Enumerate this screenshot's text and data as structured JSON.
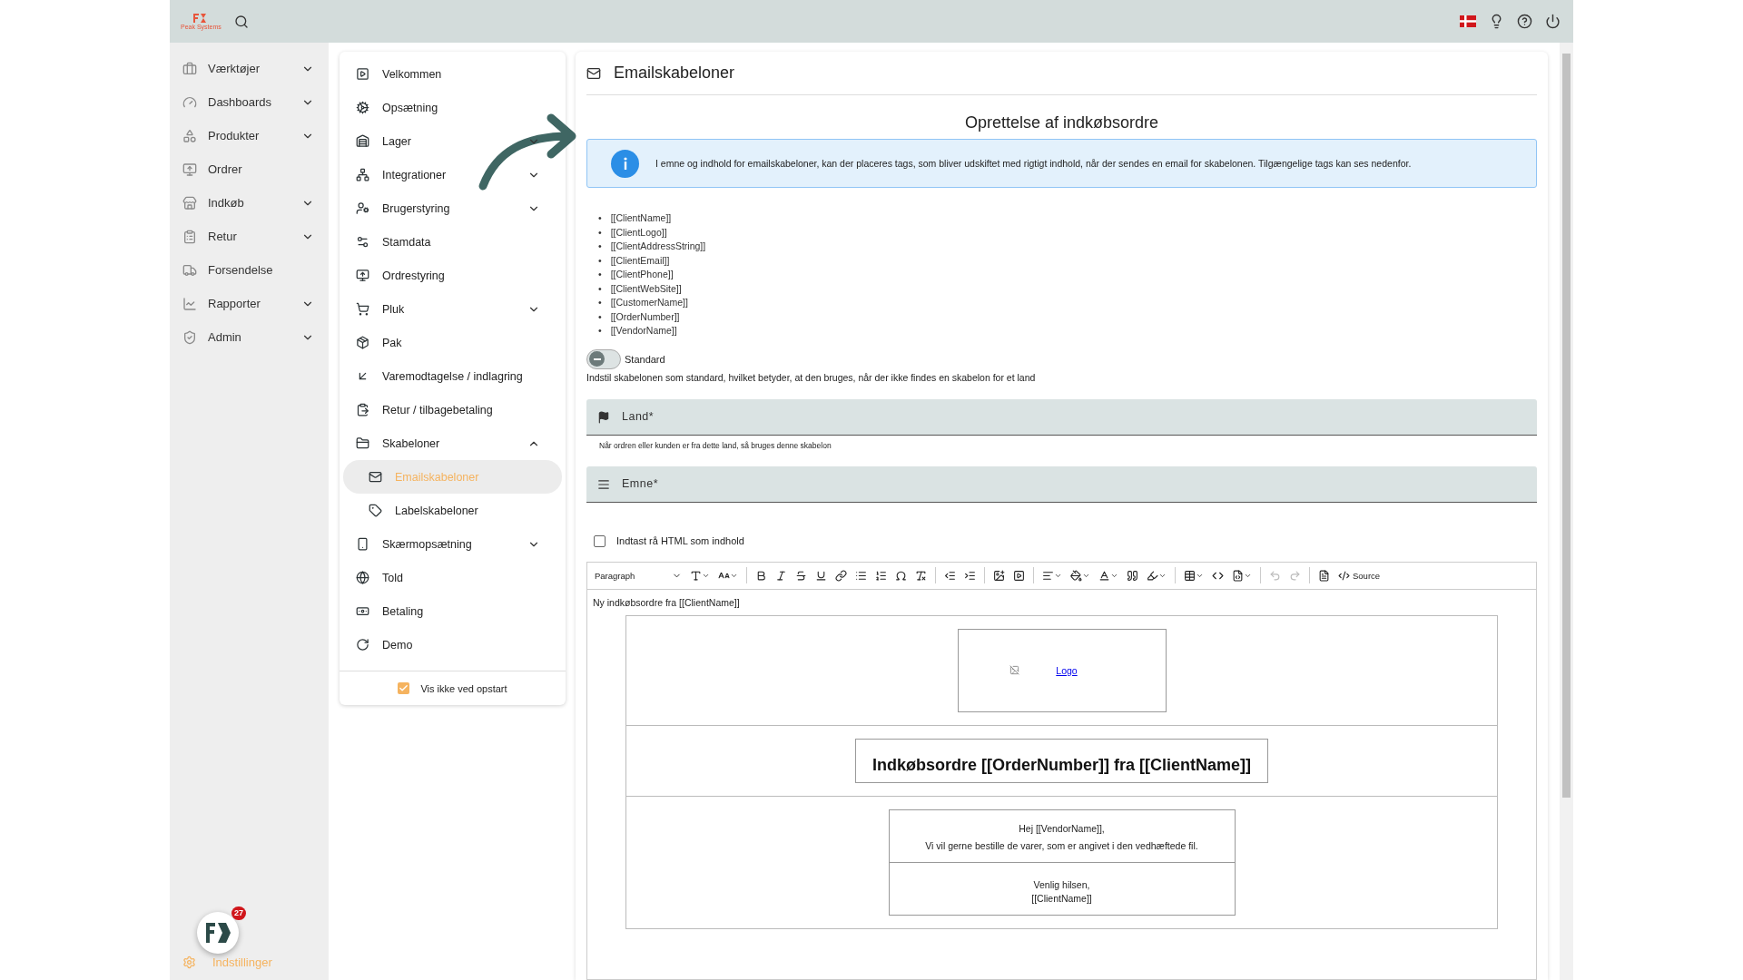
{
  "brand": "Peak Systems",
  "sidebar": {
    "items": [
      {
        "label": "Værktøjer",
        "has_submenu": true
      },
      {
        "label": "Dashboards",
        "has_submenu": true
      },
      {
        "label": "Produkter",
        "has_submenu": true
      },
      {
        "label": "Ordrer",
        "has_submenu": false
      },
      {
        "label": "Indkøb",
        "has_submenu": true
      },
      {
        "label": "Retur",
        "has_submenu": true
      },
      {
        "label": "Forsendelse",
        "has_submenu": false
      },
      {
        "label": "Rapporter",
        "has_submenu": true
      },
      {
        "label": "Admin",
        "has_submenu": true
      }
    ],
    "notification_count": "27",
    "settings_label": "Indstillinger"
  },
  "settings_menu": {
    "items": [
      {
        "label": "Velkommen",
        "has_submenu": false
      },
      {
        "label": "Opsætning",
        "has_submenu": false
      },
      {
        "label": "Lager",
        "has_submenu": true,
        "expanded": false
      },
      {
        "label": "Integrationer",
        "has_submenu": true,
        "expanded": false
      },
      {
        "label": "Brugerstyring",
        "has_submenu": true,
        "expanded": false
      },
      {
        "label": "Stamdata",
        "has_submenu": false
      },
      {
        "label": "Ordrestyring",
        "has_submenu": false
      },
      {
        "label": "Pluk",
        "has_submenu": true,
        "expanded": false
      },
      {
        "label": "Pak",
        "has_submenu": false
      },
      {
        "label": "Varemodtagelse / indlagring",
        "has_submenu": false
      },
      {
        "label": "Retur / tilbagebetaling",
        "has_submenu": false
      },
      {
        "label": "Skabeloner",
        "has_submenu": true,
        "expanded": true,
        "children": [
          {
            "label": "Emailskabeloner",
            "selected": true
          },
          {
            "label": "Labelskabeloner",
            "selected": false
          }
        ]
      },
      {
        "label": "Skærmopsætning",
        "has_submenu": true,
        "expanded": false
      },
      {
        "label": "Told",
        "has_submenu": false
      },
      {
        "label": "Betaling",
        "has_submenu": false
      },
      {
        "label": "Demo",
        "has_submenu": false
      }
    ],
    "footer": {
      "label": "Vis ikke ved opstart",
      "checked": true
    }
  },
  "page": {
    "header": "Emailskabeloner",
    "title": "Oprettelse af indkøbsordre",
    "info": "I emne og indhold for emailskabeloner, kan der placeres tags, som bliver udskiftet med rigtigt indhold, når der sendes en email for skabelonen. Tilgængelige tags kan ses nedenfor.",
    "tag_marker": "•",
    "tags": [
      "[[ClientName]]",
      "[[ClientLogo]]",
      "[[ClientAddressString]]",
      "[[ClientEmail]]",
      "[[ClientPhone]]",
      "[[ClientWebSite]]",
      "[[CustomerName]]",
      "[[OrderNumber]]",
      "[[VendorName]]"
    ],
    "standard_toggle": {
      "label": "Standard",
      "on": false,
      "help": "Indstil skabelonen som standard, hvilket betyder, at den bruges, når der ikke findes en skabelon for et land"
    },
    "country_field": {
      "placeholder": "Land*",
      "help": "Når ordren eller kunden er fra dette land, så bruges denne skabelon"
    },
    "subject_field": {
      "placeholder": "Emne*"
    },
    "raw_html": {
      "label": "Indtast rå HTML som indhold",
      "checked": false
    },
    "editor": {
      "block_style": "Paragraph",
      "source_label": "Source",
      "undo": {
        "disabled": true
      },
      "redo": {
        "disabled": true
      },
      "first_line": "Ny indkøbsordre fra [[ClientName]]",
      "logo_link": "Logo",
      "heading": "Indkøbsordre [[OrderNumber]] fra [[ClientName]]",
      "greeting": "Hej [[VendorName]],",
      "body": "Vi vil gerne bestille de varer, som er angivet i den vedhæftede fil.",
      "closing": "Venlig hilsen,",
      "signature": "[[ClientName]]"
    }
  }
}
